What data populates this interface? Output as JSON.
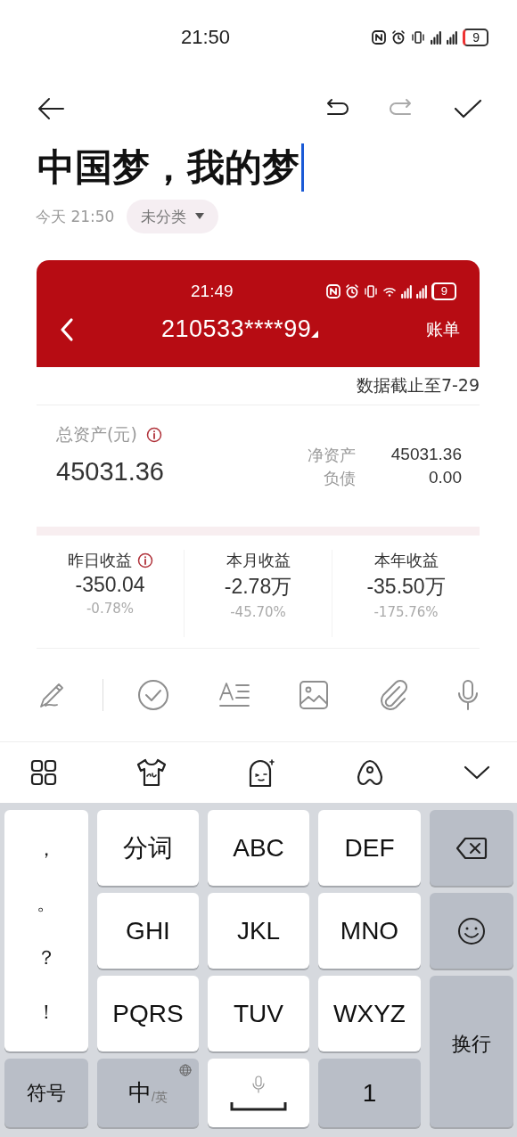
{
  "status_bar": {
    "time": "21:50",
    "battery": "9"
  },
  "toolbar": {
    "undo": {
      "disabled": false
    },
    "redo": {
      "disabled": true
    }
  },
  "note": {
    "title": "中国梦，我的梦",
    "date": "今天 21:50",
    "category": "未分类"
  },
  "screenshot": {
    "status_time": "21:49",
    "battery": "9",
    "account": "210533****99",
    "bill": "账单",
    "data_date": "数据截止至7-29",
    "total_label": "总资产(元)",
    "total_value": "45031.36",
    "details": [
      {
        "label": "净资产",
        "value": "45031.36"
      },
      {
        "label": "负债",
        "value": "0.00"
      }
    ],
    "earnings": [
      {
        "label": "昨日收益",
        "info": true,
        "value": "-350.04",
        "percent": "-0.78%"
      },
      {
        "label": "本月收益",
        "info": false,
        "value": "-2.78万",
        "percent": "-45.70%"
      },
      {
        "label": "本年收益",
        "info": false,
        "value": "-35.50万",
        "percent": "-175.76%"
      }
    ]
  },
  "keyboard": {
    "keys": [
      {
        "kind": "punct",
        "chars": [
          "，",
          "。",
          "？",
          "！"
        ]
      },
      {
        "kind": "text",
        "label": "分词"
      },
      {
        "kind": "text",
        "label": "ABC"
      },
      {
        "kind": "text",
        "label": "DEF"
      },
      {
        "kind": "backspace"
      },
      {
        "kind": "text",
        "label": "GHI"
      },
      {
        "kind": "text",
        "label": "JKL"
      },
      {
        "kind": "text",
        "label": "MNO"
      },
      {
        "kind": "emoji"
      },
      {
        "kind": "text",
        "label": "PQRS"
      },
      {
        "kind": "text",
        "label": "TUV"
      },
      {
        "kind": "text",
        "label": "WXYZ"
      },
      {
        "kind": "enter",
        "label": "换行"
      },
      {
        "kind": "func",
        "label": "符号"
      },
      {
        "kind": "lang",
        "label": "中",
        "alt": "/英"
      },
      {
        "kind": "space"
      },
      {
        "kind": "func",
        "label": "1"
      }
    ]
  }
}
